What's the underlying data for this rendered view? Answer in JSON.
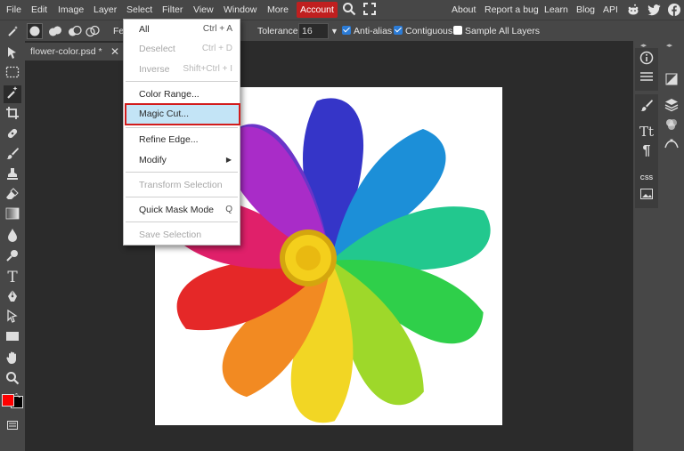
{
  "menubar": {
    "items": [
      "File",
      "Edit",
      "Image",
      "Layer",
      "Select",
      "Filter",
      "View",
      "Window",
      "More"
    ],
    "account": "Account",
    "right_links": [
      "About",
      "Report a bug",
      "Learn",
      "Blog",
      "API"
    ],
    "colors": {
      "account_bg": "#c01f1f",
      "bar_bg": "#474747"
    }
  },
  "options": {
    "feather_prefix": "Fe",
    "tolerance_label": "Tolerance:",
    "tolerance_value": "16",
    "antialias_label": "Anti-alias",
    "contiguous_label": "Contiguous",
    "sample_all_label": "Sample All Layers"
  },
  "tab": {
    "title": "flower-color.psd *",
    "close": "✕"
  },
  "dropdown": {
    "items": [
      {
        "label": "All",
        "shortcut": "Ctrl + A",
        "disabled": false
      },
      {
        "label": "Deselect",
        "shortcut": "Ctrl + D",
        "disabled": true
      },
      {
        "label": "Inverse",
        "shortcut": "Shift+Ctrl + I",
        "disabled": true
      },
      {
        "label": "Color Range...",
        "shortcut": "",
        "disabled": false
      },
      {
        "label": "Magic Cut...",
        "shortcut": "",
        "disabled": false,
        "highlighted": true
      },
      {
        "label": "Refine Edge...",
        "shortcut": "",
        "disabled": false
      },
      {
        "label": "Modify",
        "shortcut": "▶",
        "disabled": false
      },
      {
        "label": "Transform Selection",
        "shortcut": "",
        "disabled": true
      },
      {
        "label": "Quick Mask Mode",
        "shortcut": "Q",
        "disabled": false
      },
      {
        "label": "Save Selection",
        "shortcut": "",
        "disabled": true
      }
    ]
  },
  "right_panel": {
    "css_label": "CSS",
    "paragraph_glyph": "¶",
    "type_glyph": "Tt"
  },
  "colors": {
    "foreground": "#ff0000",
    "background": "#000000"
  }
}
